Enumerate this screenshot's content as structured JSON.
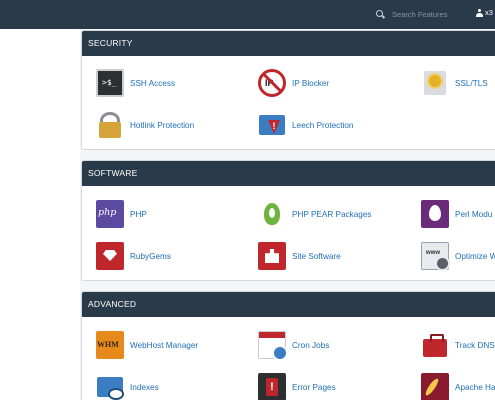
{
  "header": {
    "search_placeholder": "Search Features",
    "user": "x3"
  },
  "sections": {
    "security": {
      "title": "SECURITY",
      "items": [
        {
          "label": "SSH Access"
        },
        {
          "label": "IP Blocker"
        },
        {
          "label": "SSL/TLS"
        },
        {
          "label": "Hotlink Protection"
        },
        {
          "label": "Leech Protection"
        }
      ]
    },
    "software": {
      "title": "SOFTWARE",
      "items": [
        {
          "label": "PHP"
        },
        {
          "label": "PHP PEAR Packages"
        },
        {
          "label": "Perl Modu"
        },
        {
          "label": "RubyGems"
        },
        {
          "label": "Site Software"
        },
        {
          "label": "Optimize W"
        }
      ]
    },
    "advanced": {
      "title": "ADVANCED",
      "items": [
        {
          "label": "WebHost Manager"
        },
        {
          "label": "Cron Jobs"
        },
        {
          "label": "Track DNS"
        },
        {
          "label": "Indexes"
        },
        {
          "label": "Error Pages"
        },
        {
          "label": "Apache Ha"
        }
      ]
    }
  },
  "icons": {
    "ssh": "php"
  },
  "colors": {
    "header_bg": "#293a4a",
    "link": "#1e6fb8"
  }
}
